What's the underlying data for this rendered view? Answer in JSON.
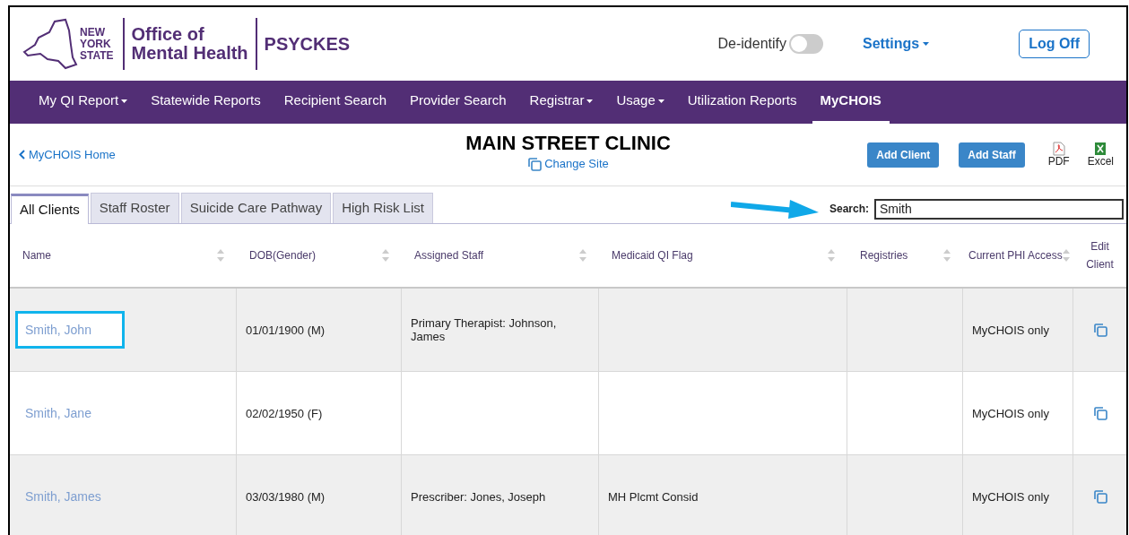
{
  "header": {
    "logo_text": [
      "NEW",
      "YORK",
      "STATE"
    ],
    "office": [
      "Office of",
      "Mental Health"
    ],
    "app_name": "PSYCKES",
    "deidentify": {
      "label": "De-identify",
      "on": false
    },
    "settings": "Settings",
    "log_off": "Log Off"
  },
  "nav": [
    {
      "label": "My QI Report",
      "dropdown": true,
      "selected": false
    },
    {
      "label": "Statewide Reports",
      "dropdown": false,
      "selected": false
    },
    {
      "label": "Recipient Search",
      "dropdown": false,
      "selected": false
    },
    {
      "label": "Provider Search",
      "dropdown": false,
      "selected": false
    },
    {
      "label": "Registrar",
      "dropdown": true,
      "selected": false
    },
    {
      "label": "Usage",
      "dropdown": true,
      "selected": false
    },
    {
      "label": "Utilization Reports",
      "dropdown": false,
      "selected": false
    },
    {
      "label": "MyCHOIS",
      "dropdown": false,
      "selected": true
    }
  ],
  "page": {
    "back_link": "MyCHOIS Home",
    "title": "MAIN STREET CLINIC",
    "change_site": "Change Site",
    "buttons": [
      "Add Client",
      "Add Staff"
    ],
    "exports": [
      {
        "kind": "pdf",
        "label": "PDF"
      },
      {
        "kind": "excel",
        "label": "Excel"
      }
    ]
  },
  "tabs": [
    {
      "label": "All Clients",
      "selected": true
    },
    {
      "label": "Staff Roster",
      "selected": false
    },
    {
      "label": "Suicide Care Pathway",
      "selected": false
    },
    {
      "label": "High Risk List",
      "selected": false
    }
  ],
  "search": {
    "label": "Search:",
    "value": "Smith",
    "annotation_arrow": true
  },
  "table": {
    "columns": [
      {
        "label": "Name",
        "sortable": true
      },
      {
        "label": "DOB(Gender)",
        "sortable": true
      },
      {
        "label": "Assigned Staff",
        "sortable": true
      },
      {
        "label": "Medicaid QI Flag",
        "sortable": true
      },
      {
        "label": "Registries",
        "sortable": true
      },
      {
        "label": "Current PHI Access",
        "sortable": true
      },
      {
        "label": "Edit Client",
        "sortable": false
      }
    ],
    "rows": [
      {
        "name": "Smith, John",
        "highlighted": true,
        "dob": "01/01/1900 (M)",
        "staff": "Primary Therapist: Johnson, James",
        "flag": "",
        "registries": "",
        "phi": "MyCHOIS only"
      },
      {
        "name": "Smith, Jane",
        "highlighted": false,
        "dob": "02/02/1950 (F)",
        "staff": "",
        "flag": "",
        "registries": "",
        "phi": "MyCHOIS only"
      },
      {
        "name": "Smith, James",
        "highlighted": false,
        "dob": "03/03/1980 (M)",
        "staff": "Prescriber: Jones, Joseph",
        "flag": "MH Plcmt Consid",
        "registries": "",
        "phi": "MyCHOIS only"
      }
    ]
  }
}
